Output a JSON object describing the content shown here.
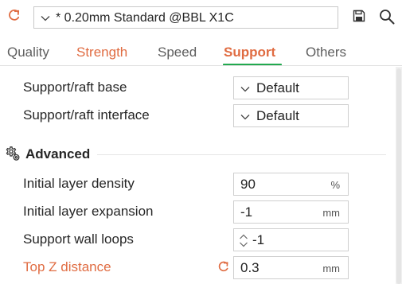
{
  "toolbar": {
    "preset_value": "* 0.20mm Standard @BBL X1C"
  },
  "tabs": [
    {
      "label": "Quality"
    },
    {
      "label": "Strength"
    },
    {
      "label": "Speed"
    },
    {
      "label": "Support"
    },
    {
      "label": "Others"
    }
  ],
  "active_tab": "Support",
  "rows": {
    "raft_base": {
      "label": "Support/raft base",
      "value": "Default"
    },
    "raft_interface": {
      "label": "Support/raft interface",
      "value": "Default"
    },
    "advanced": {
      "title": "Advanced"
    },
    "initial_layer_density": {
      "label": "Initial layer density",
      "value": "90",
      "unit": "%"
    },
    "initial_layer_expansion": {
      "label": "Initial layer expansion",
      "value": "-1",
      "unit": "mm"
    },
    "support_wall_loops": {
      "label": "Support wall loops",
      "value": "-1"
    },
    "top_z_distance": {
      "label": "Top Z distance",
      "value": "0.3",
      "unit": "mm"
    }
  },
  "colors": {
    "accent_orange": "#e06c42",
    "accent_green": "#22a94f",
    "text": "#262626",
    "border": "#cfcfcf"
  },
  "icons": [
    "reset-icon",
    "chevron-down-icon",
    "save-icon",
    "search-icon",
    "gear-icon",
    "stepper-icon"
  ]
}
